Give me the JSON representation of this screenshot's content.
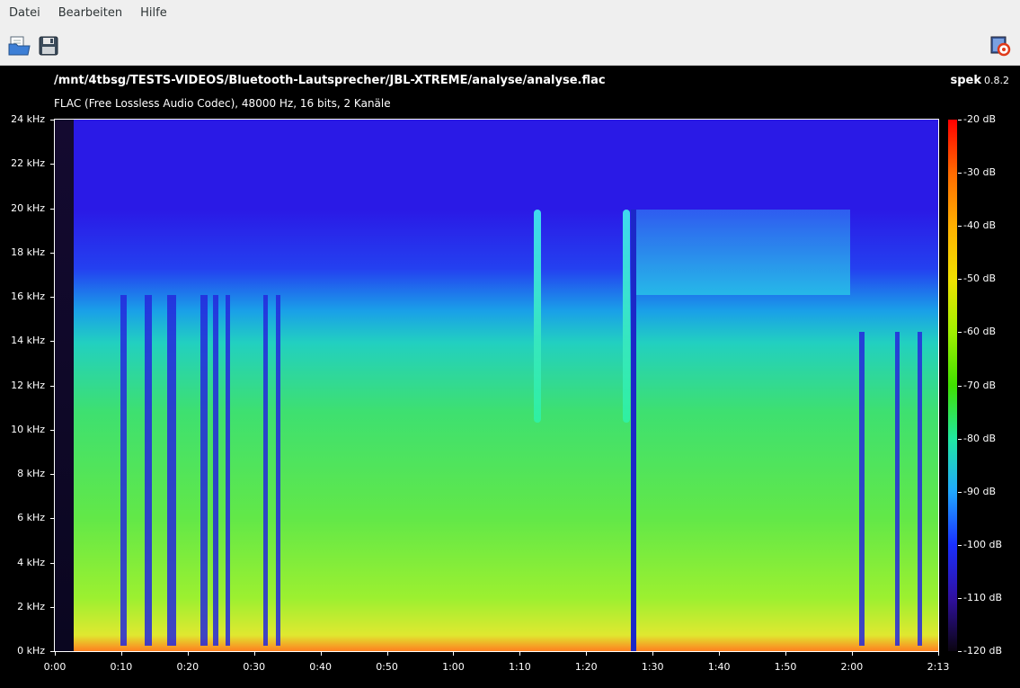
{
  "menubar": {
    "items": [
      "Datei",
      "Bearbeiten",
      "Hilfe"
    ]
  },
  "toolbar": {
    "open_icon": "open-file-icon",
    "save_icon": "save-icon",
    "about_icon": "about-icon"
  },
  "spectrogram": {
    "file_path": "/mnt/4tbsg/TESTS-VIDEOS/Bluetooth-Lautsprecher/JBL-XTREME/analyse/analyse.flac",
    "file_info": "FLAC (Free Lossless Audio Codec), 48000 Hz, 16 bits, 2 Kanäle",
    "brand_name": "spek",
    "brand_version": "0.8.2",
    "y_ticks": [
      "24 kHz",
      "22 kHz",
      "20 kHz",
      "18 kHz",
      "16 kHz",
      "14 kHz",
      "12 kHz",
      "10 kHz",
      "8 kHz",
      "6 kHz",
      "4 kHz",
      "2 kHz",
      "0 kHz"
    ],
    "x_ticks": [
      "0:00",
      "0:10",
      "0:20",
      "0:30",
      "0:40",
      "0:50",
      "1:00",
      "1:10",
      "1:20",
      "1:30",
      "1:40",
      "1:50",
      "2:00",
      "2:13"
    ],
    "color_ticks": [
      "-20 dB",
      "-30 dB",
      "-40 dB",
      "-50 dB",
      "-60 dB",
      "-70 dB",
      "-80 dB",
      "-90 dB",
      "-100 dB",
      "-110 dB",
      "-120 dB"
    ],
    "colors": {
      "background": "#000000",
      "low_energy": "#2a1ae6",
      "mid_energy": "#3ee070",
      "high_energy": "#ff0000"
    }
  }
}
